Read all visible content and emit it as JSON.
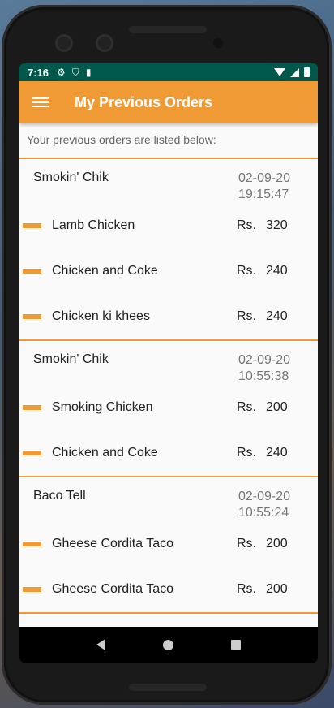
{
  "status_bar": {
    "time": "7:16"
  },
  "app_bar": {
    "title": "My Previous Orders"
  },
  "subtitle": "Your previous orders are listed below:",
  "orders": [
    {
      "restaurant": "Smokin' Chik",
      "date": "02-09-20",
      "time": "19:15:47",
      "items": [
        {
          "name": "Lamb Chicken",
          "currency": "Rs.",
          "price": "320"
        },
        {
          "name": "Chicken and Coke",
          "currency": "Rs.",
          "price": "240"
        },
        {
          "name": "Chicken ki khees",
          "currency": "Rs.",
          "price": "240"
        }
      ]
    },
    {
      "restaurant": "Smokin' Chik",
      "date": "02-09-20",
      "time": "10:55:38",
      "items": [
        {
          "name": "Smoking Chicken",
          "currency": "Rs.",
          "price": "200"
        },
        {
          "name": "Chicken and Coke",
          "currency": "Rs.",
          "price": "240"
        }
      ]
    },
    {
      "restaurant": "Baco Tell",
      "date": "02-09-20",
      "time": "10:55:24",
      "items": [
        {
          "name": "Gheese Cordita Taco",
          "currency": "Rs.",
          "price": "200"
        },
        {
          "name": "Gheese Cordita Taco",
          "currency": "Rs.",
          "price": "200"
        }
      ]
    }
  ],
  "colors": {
    "accent": "#f09a36",
    "status_bar": "#00574b"
  }
}
